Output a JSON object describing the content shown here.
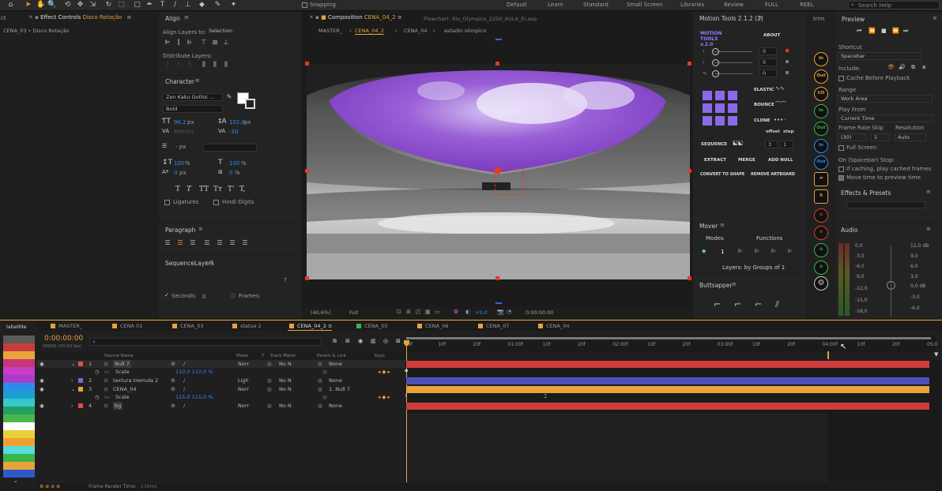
{
  "toolbar": {
    "snapping": "Snapping",
    "workspaces": [
      "Default",
      "Learn",
      "Standard",
      "Small Screen",
      "Libraries",
      "Review",
      "FULL",
      "REEL"
    ],
    "search_placeholder": "Search Help"
  },
  "effect_controls": {
    "tab_prefix": "Effect Controls",
    "layer": "Disco Rotação",
    "breadcrumb": "CENA_03 • Disco Rotação",
    "side_label": "ct"
  },
  "align": {
    "title": "Align",
    "align_to_label": "Align Layers to:",
    "align_to_value": "Selection",
    "distribute_label": "Distribute Layers:"
  },
  "character": {
    "title": "Character",
    "font": "Zen Kaku Gothic ...",
    "style": "Bold",
    "size": "96,2",
    "size_unit": "px",
    "leading": "102,8",
    "leading_unit": "px",
    "kerning": "Metrics",
    "tracking": "-30",
    "stroke_unit": "- px",
    "vscale": "100",
    "vscale_unit": "%",
    "hscale": "100",
    "hscale_unit": "%",
    "baseline": "0",
    "baseline_unit": "px",
    "tsume": "0",
    "tsume_unit": "%",
    "ligatures": "Ligatures",
    "hindi": "Hindi Digits",
    "styles": [
      "T",
      "T",
      "TT",
      "Tт",
      "T'",
      "T,"
    ]
  },
  "paragraph": {
    "title": "Paragraph"
  },
  "sequence_layers": {
    "title": "SequenceLayers",
    "help": "?",
    "seconds_label": "Seconds:",
    "seconds_value": "0",
    "frames_label": "Frames:"
  },
  "composition": {
    "tab_label": "Composition",
    "comp_name": "CENA_04_2",
    "flowchart": "Flowchart: Rio_Olympics_2250_AULA_El.aep",
    "nav": [
      "MASTER_",
      "CENA_04_2",
      "CENA_04",
      "estadio olimpico"
    ],
    "zoom": "(40,6%)",
    "quality": "Full",
    "exposure": "+0,0",
    "timecode": "0:00:00:00"
  },
  "motion_tools": {
    "title": "Motion Tools 2.1.2 (2)",
    "logo": "MOTION TOOLS v.2.0",
    "about": "ABOUT",
    "values": [
      "0",
      "0",
      "0"
    ],
    "elastic": "ELASTIC",
    "bounce": "BOUNCE",
    "clone": "CLONE",
    "offset": "offset",
    "step": "step",
    "sequence": "SEQUENCE",
    "seq_offset": "3",
    "seq_step": "1",
    "extract": "EXTRACT",
    "merge": "MERGE",
    "add_null": "ADD NULL",
    "convert": "CONVERT TO SHAPE",
    "remove_artboard": "REMOVE ARTBOARD"
  },
  "mover": {
    "title": "Mover",
    "modes": "Modes",
    "functions": "Functions",
    "mode_value": "1",
    "layers": "Layers: by Groups of 1"
  },
  "buttsapper": {
    "title": "Buttsapper"
  },
  "trim": {
    "title": "trim",
    "buttons": [
      "In",
      "Out",
      "I/O",
      "In",
      "Out",
      "In",
      "Out",
      "",
      ""
    ]
  },
  "preview": {
    "title": "Preview",
    "shortcut_label": "Shortcut",
    "shortcut_value": "Spacebar",
    "include_label": "Include:",
    "cache_label": "Cache Before Playback",
    "range_label": "Range",
    "range_value": "Work Area",
    "play_from_label": "Play From",
    "play_from_value": "Current Time",
    "frame_rate_label": "Frame Rate",
    "skip_label": "Skip",
    "resolution_label": "Resolution",
    "frame_rate_value": "(30)",
    "skip_value": "1",
    "resolution_value": "Auto",
    "full_screen": "Full Screen",
    "on_stop": "On (Spacebar) Stop:",
    "if_caching": "If caching, play cached frames",
    "move_time": "Move time to preview time"
  },
  "effects_presets": {
    "title": "Effects & Presets"
  },
  "audio": {
    "title": "Audio",
    "left_ticks": [
      "0,0",
      "-3,0",
      "-6,0",
      "-9,0",
      "-12,0",
      "-15,0",
      "-18,0"
    ],
    "right_ticks": [
      "12,0 dB",
      "9,0",
      "6,0",
      "3,0",
      "0,0 dB",
      "-3,0",
      "-6,0"
    ]
  },
  "timeline": {
    "panel_label": "labelMe",
    "tabs": [
      {
        "name": "MASTER_",
        "color": "#e8a33a"
      },
      {
        "name": "CENA 01",
        "color": "#e8a33a"
      },
      {
        "name": "CENA_03",
        "color": "#e8a33a"
      },
      {
        "name": "statue 2",
        "color": "#e8a33a"
      },
      {
        "name": "CENA_04_2",
        "color": "#e8a33a"
      },
      {
        "name": "CENA_05",
        "color": "#3ab54a"
      },
      {
        "name": "CENA_06",
        "color": "#e8a33a"
      },
      {
        "name": "CENA_07",
        "color": "#e8a33a"
      },
      {
        "name": "CENA_04",
        "color": "#e8a33a"
      }
    ],
    "timecode": "0:00:00:00",
    "fps": "00000 (30.00 fps)",
    "col_source": "Source Name",
    "col_mode": "Mode",
    "col_t": "T",
    "col_trackmatte": "Track Matte",
    "col_parent": "Parent & Link",
    "col_keys": "Keys",
    "ruler": [
      "0f",
      "10f",
      "20f",
      "01:00f",
      "10f",
      "20f",
      "02:00f",
      "10f",
      "20f",
      "03:00f",
      "10f",
      "20f",
      "04:00f",
      "10f",
      "20f",
      "05:0"
    ],
    "layers": [
      {
        "num": "1",
        "name": "Null 7",
        "color": "#e84a4a",
        "mode": "Norr",
        "matte": "No N",
        "parent": "None",
        "bar": "#cf3c3c"
      },
      {
        "prop": "Scale",
        "value": "110,0 110,0 %"
      },
      {
        "num": "2",
        "name": "textura tremula 2",
        "color": "#6e6ed8",
        "mode": "Ligh",
        "matte": "No N",
        "parent": "None",
        "bar": "#4a52b8"
      },
      {
        "num": "3",
        "name": "CENA_04",
        "color": "#e8a33a",
        "mode": "Norr",
        "matte": "No N",
        "parent": "1. Null 7",
        "bar": "#e8a33a"
      },
      {
        "prop": "Scale",
        "value": "115,0 115,0 %"
      },
      {
        "num": "4",
        "name": "bg",
        "color": "#e84a4a",
        "mode": "Norr",
        "matte": "No N",
        "parent": "None",
        "bar": "#cf3c3c"
      }
    ],
    "footer": "Frame Render Time:",
    "footer_value": "136ms"
  },
  "label_colors": [
    "#5a5a5a",
    "#c83c3c",
    "#e8a33a",
    "#c8367a",
    "#c83cc8",
    "#a83cc8",
    "#2d8ceb",
    "#1aa0d0",
    "#36c8c8",
    "#22a064",
    "#4ab54a",
    "#ffffff",
    "#e8d23a",
    "#f0a030",
    "#5adada",
    "#3ab54a",
    "#e8a33a",
    "#2d5ac8"
  ]
}
